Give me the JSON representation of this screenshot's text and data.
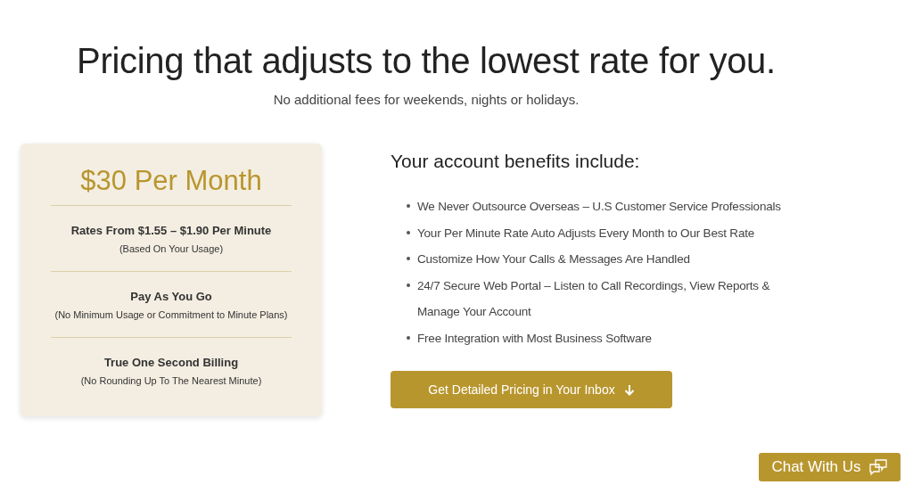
{
  "heading": "Pricing that adjusts to the lowest rate for you.",
  "subheading": "No additional fees for weekends, nights or holidays.",
  "plan": {
    "price": "$30 Per Month",
    "features": [
      {
        "title": "Rates From $1.55 – $1.90 Per Minute",
        "note": "(Based On Your Usage)"
      },
      {
        "title": "Pay As You Go",
        "note": "(No Minimum Usage or Commitment to Minute Plans)"
      },
      {
        "title": "True One Second Billing",
        "note": "(No Rounding Up To The Nearest Minute)"
      }
    ]
  },
  "benefits": {
    "title": "Your account benefits include:",
    "items": [
      "We Never Outsource Overseas – U.S Customer Service Professionals",
      "Your Per Minute Rate Auto Adjusts Every Month to Our Best Rate",
      "Customize How Your Calls & Messages Are Handled",
      "24/7 Secure Web Portal – Listen to Call Recordings, View Reports & Manage Your Account",
      "Free Integration with Most Business Software"
    ]
  },
  "cta_button": "Get Detailed Pricing in Your Inbox",
  "chat_button": "Chat With Us"
}
